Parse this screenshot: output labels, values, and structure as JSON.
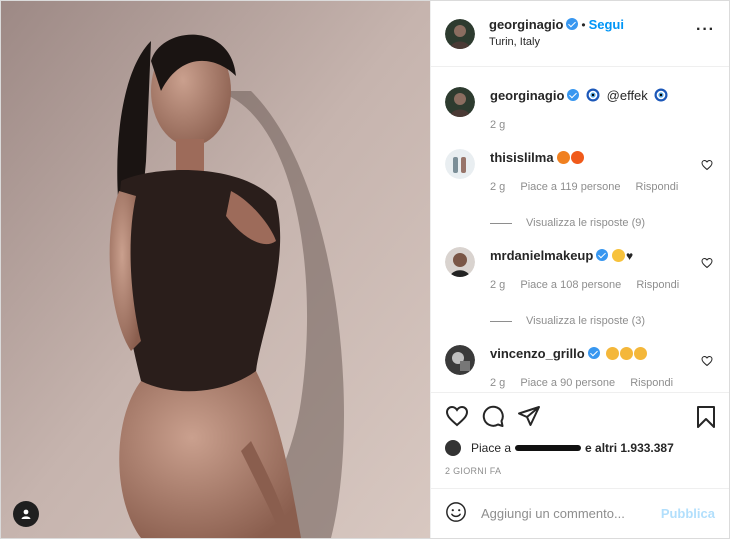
{
  "post": {
    "author": "georginagio",
    "follow_label": "Segui",
    "location": "Turin, Italy",
    "more_label": "···"
  },
  "caption": {
    "username": "georginagio",
    "mention": "@effek",
    "time": "2 g"
  },
  "comments": [
    {
      "username": "thisislilma",
      "time": "2 g",
      "likes": "Piace a 119 persone",
      "reply": "Rispondi",
      "view_replies": "Visualizza le risposte (9)",
      "emoji": [
        "fire",
        "fire"
      ]
    },
    {
      "username": "mrdanielmakeup",
      "time": "2 g",
      "likes": "Piace a 108 persone",
      "reply": "Rispondi",
      "view_replies": "Visualizza le risposte (3)",
      "emoji": [
        "hug",
        "black-heart"
      ]
    },
    {
      "username": "vincenzo_grillo",
      "time": "2 g",
      "likes": "Piace a 90 persone",
      "reply": "Rispondi",
      "emoji": [
        "clap",
        "clap",
        "clap"
      ]
    }
  ],
  "likes": {
    "prefix": "Piace a",
    "suffix": "e altri 1.933.387"
  },
  "date": "2 GIORNI FA",
  "add_comment": {
    "placeholder": "Aggiungi un commento...",
    "publish": "Pubblica"
  },
  "colors": {
    "accent": "#0095f6",
    "verified": "#3897f0",
    "muted": "#8e8e8e",
    "publish_disabled": "#b2dffc"
  },
  "icons": [
    "user-tag-icon",
    "verified-badge-icon",
    "more-options-icon",
    "nazar-icon",
    "heart-icon",
    "comment-icon",
    "share-icon",
    "bookmark-icon",
    "emoji-icon"
  ]
}
